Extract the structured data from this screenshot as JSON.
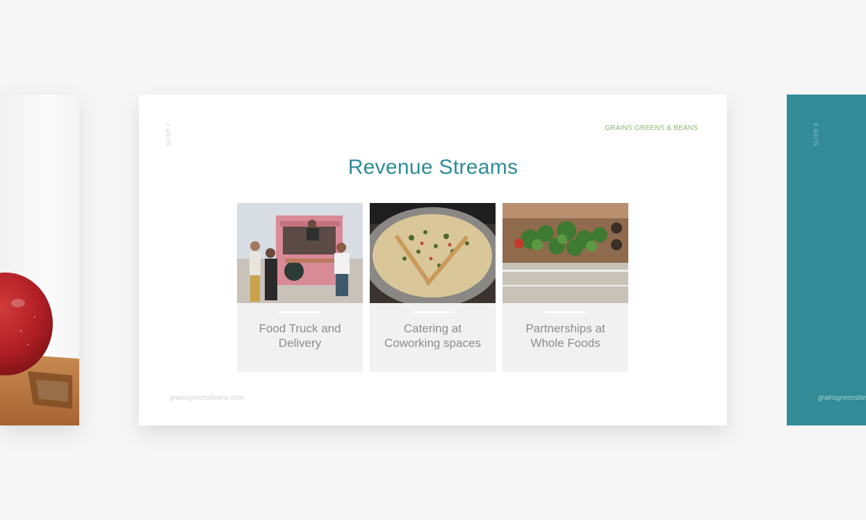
{
  "slides": {
    "left": {
      "image_name": "apple-on-cutting-board"
    },
    "main": {
      "slide_number": "SLIDE 7",
      "brand": "GRAINS GREENS & BEANS",
      "title": "Revenue Streams",
      "cards": [
        {
          "label": "Food Truck and Delivery",
          "image_name": "food-truck-photo"
        },
        {
          "label": "Catering at Coworking spaces",
          "image_name": "grain-salad-bowl-photo"
        },
        {
          "label": "Partnerships at Whole Foods",
          "image_name": "produce-display-photo"
        }
      ],
      "footer_url": "grainsgreensbeans.com"
    },
    "right": {
      "slide_number": "SLIDE 4",
      "footer_url": "grainsgreensbea"
    }
  },
  "colors": {
    "background": "#f6f6f6",
    "title": "#2e8c98",
    "brand": "#8ab56a",
    "card_bg": "#f1f1f1",
    "teal_slide": "#328b97"
  }
}
